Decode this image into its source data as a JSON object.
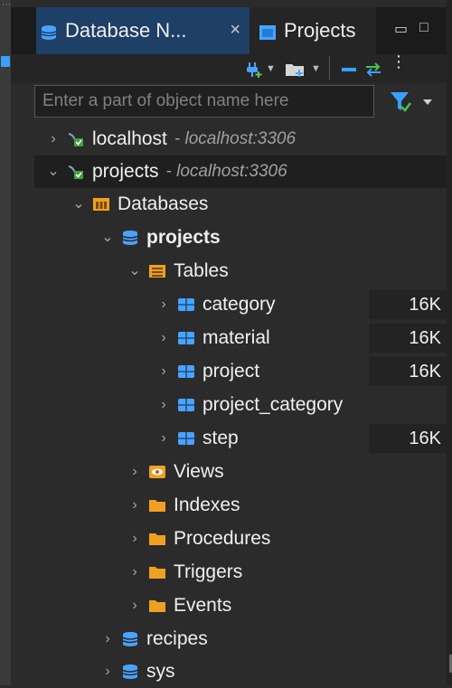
{
  "tabs": [
    {
      "label": "Database N...",
      "active": true,
      "close": "×"
    },
    {
      "label": "Projects",
      "active": false
    }
  ],
  "window_controls": {
    "minimize": "▭",
    "maximize": "□"
  },
  "search": {
    "placeholder": "Enter a part of object name here",
    "value": ""
  },
  "colors": {
    "accent": "#3aa0ff",
    "folder": "#f0a020",
    "db": "#4aa3ff",
    "tab_active": "#1e3f66"
  },
  "tree": {
    "connections": [
      {
        "name": "localhost",
        "host": "- localhost:3306",
        "expanded": false
      },
      {
        "name": "projects",
        "host": "- localhost:3306",
        "expanded": true
      }
    ],
    "databases_label": "Databases",
    "db_projects": "projects",
    "tables_label": "Tables",
    "tables": [
      {
        "name": "category",
        "size": "16K"
      },
      {
        "name": "material",
        "size": "16K"
      },
      {
        "name": "project",
        "size": "16K"
      },
      {
        "name": "project_category",
        "size": ""
      },
      {
        "name": "step",
        "size": "16K"
      }
    ],
    "folders": [
      "Views",
      "Indexes",
      "Procedures",
      "Triggers",
      "Events"
    ],
    "other_dbs": [
      "recipes",
      "sys"
    ]
  }
}
